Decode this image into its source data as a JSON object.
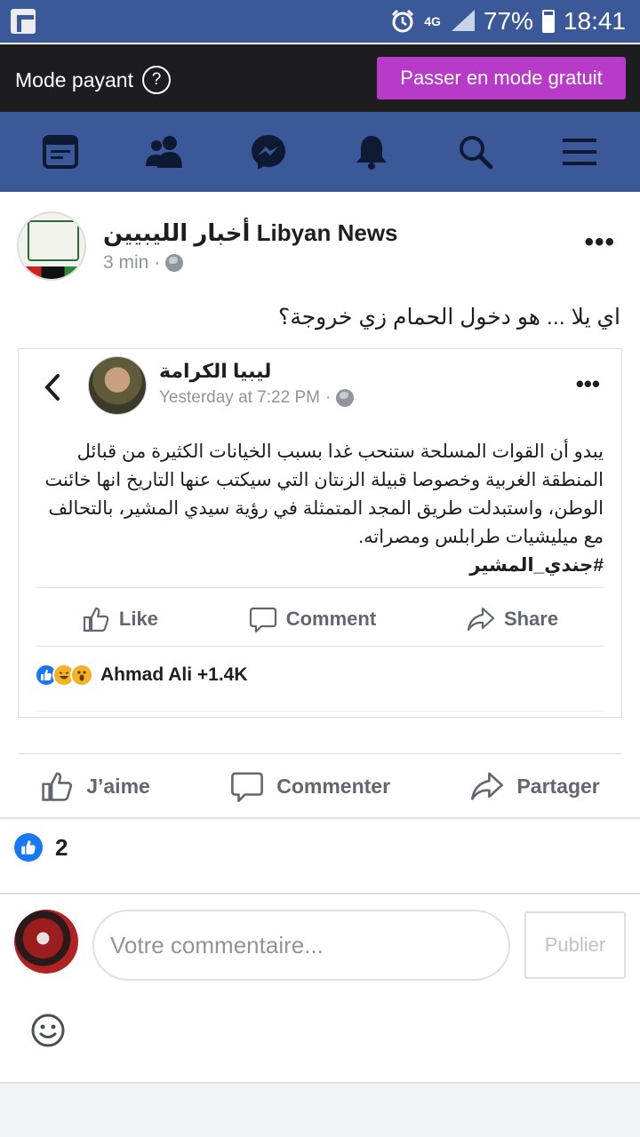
{
  "status_bar": {
    "network": "4G",
    "battery": "77%",
    "time": "18:41"
  },
  "mode_bar": {
    "label": "Mode payant",
    "help": "?",
    "switch_button": "Passer en mode gratuit",
    "accent": "#b83ac8"
  },
  "nav": {
    "icons": [
      "feed-icon",
      "friends-icon",
      "messenger-icon",
      "notifications-icon",
      "search-icon",
      "menu-icon"
    ]
  },
  "post": {
    "page_name": "أخبار الليبيين Libyan News",
    "time": "3 min",
    "separator": "·",
    "more": "•••",
    "text": "اي يلا ... هو دخول الحمام زي خروجة؟"
  },
  "shared_post": {
    "author": "ليبيا الكرامة",
    "time": "Yesterday at 7:22 PM",
    "separator": "·",
    "more": "•••",
    "body": "يبدو أن القوات المسلحة ستنحب غدا بسبب الخيانات الكثيرة من قبائل المنطقة الغربية وخصوصا قبيلة الزنتان التي سيكتب عنها التاريخ انها خائنت الوطن، واستبدلت  طريق المجد المتمثلة في رؤية سيدي المشير، بالتحالف مع ميليشيات طرابلس ومصراته.",
    "hashtag": "#جندي_المشير",
    "actions": {
      "like": "Like",
      "comment": "Comment",
      "share": "Share"
    },
    "reactions_text": "Ahmad Ali +1.4K"
  },
  "actions": {
    "like": "J’aime",
    "comment": "Commenter",
    "share": "Partager"
  },
  "likes_count": "2",
  "comment_box": {
    "placeholder": "Votre commentaire...",
    "publish": "Publier"
  },
  "colors": {
    "facebook_blue": "#3b5998",
    "like_blue": "#1877f2"
  }
}
